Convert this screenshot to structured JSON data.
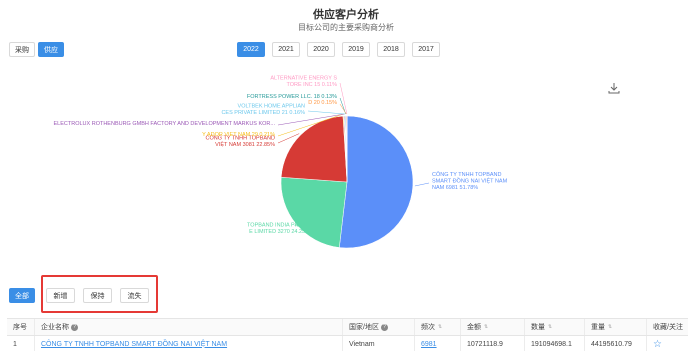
{
  "header": {
    "title": "供应客户分析",
    "subtitle": "目标公司的主要采购商分析"
  },
  "mode_tabs": [
    {
      "label": "采购",
      "active": false
    },
    {
      "label": "供应",
      "active": true
    }
  ],
  "year_tabs": [
    {
      "label": "2022",
      "active": true
    },
    {
      "label": "2021",
      "active": false
    },
    {
      "label": "2020",
      "active": false
    },
    {
      "label": "2019",
      "active": false
    },
    {
      "label": "2018",
      "active": false
    },
    {
      "label": "2017",
      "active": false
    }
  ],
  "toolbox": {
    "download_icon": "download-icon"
  },
  "chart_data": {
    "type": "pie",
    "slices": [
      {
        "label_lines": [
          "CÔNG TY TNHH TOPBAND",
          "SMART ĐỒNG NAI VIỆT NAM",
          "NAM 6981 51.78%"
        ],
        "value": 51.78,
        "color": "#5b8ff9"
      },
      {
        "label_lines": [
          "TOPBAND INDIA PRIVAT",
          "E LIMITED 3270 24.25%"
        ],
        "value": 24.25,
        "color": "#5ad8a6"
      },
      {
        "label_lines": [
          "CÔNG TY TNHH TOPBAND",
          "VIỆT NAM 3081 22.85%"
        ],
        "value": 22.85,
        "color": "#d63a35"
      },
      {
        "label_lines": [
          "Y ADOR VIET NAM 29 0.21%"
        ],
        "value": 0.21,
        "color": "#f6bd16"
      },
      {
        "label_lines": [
          "ELECTROLUX ROTHENBURG GMBH FACTORY AND DEVELOPMENT MARKUS KOR..."
        ],
        "value": 0.2,
        "color": "#9b59b6"
      },
      {
        "label_lines": [
          "VOLTBEK HOME APPLIAN",
          "CES PRIVATE LIMITED 21 0.16%"
        ],
        "value": 0.16,
        "color": "#6dc8ec"
      },
      {
        "label_lines": [
          "FORTRESS POWER LLC. 18 0.13%"
        ],
        "value": 0.13,
        "color": "#269a99"
      },
      {
        "label_lines": [
          "D 20 0.15%"
        ],
        "value": 0.15,
        "color": "#ff9845"
      },
      {
        "label_lines": [
          "ALTERNATIVE ENERGY S",
          "TORE INC 15 0.11%"
        ],
        "value": 0.11,
        "color": "#ff99c3"
      }
    ]
  },
  "filters": [
    {
      "label": "全部",
      "active": true
    },
    {
      "label": "新增",
      "active": false
    },
    {
      "label": "保持",
      "active": false
    },
    {
      "label": "流失",
      "active": false
    }
  ],
  "table": {
    "headers": [
      "序号",
      "企业名称",
      "国家/地区",
      "频次",
      "金额",
      "数量",
      "重量",
      "收藏/关注"
    ],
    "rows": [
      [
        "1",
        "CÔNG TY TNHH TOPBAND SMART ĐỒNG NAI VIỆT NAM",
        "Vietnam",
        "6981",
        "10721118.9",
        "191094698.1",
        "44195610.79",
        ""
      ]
    ]
  }
}
